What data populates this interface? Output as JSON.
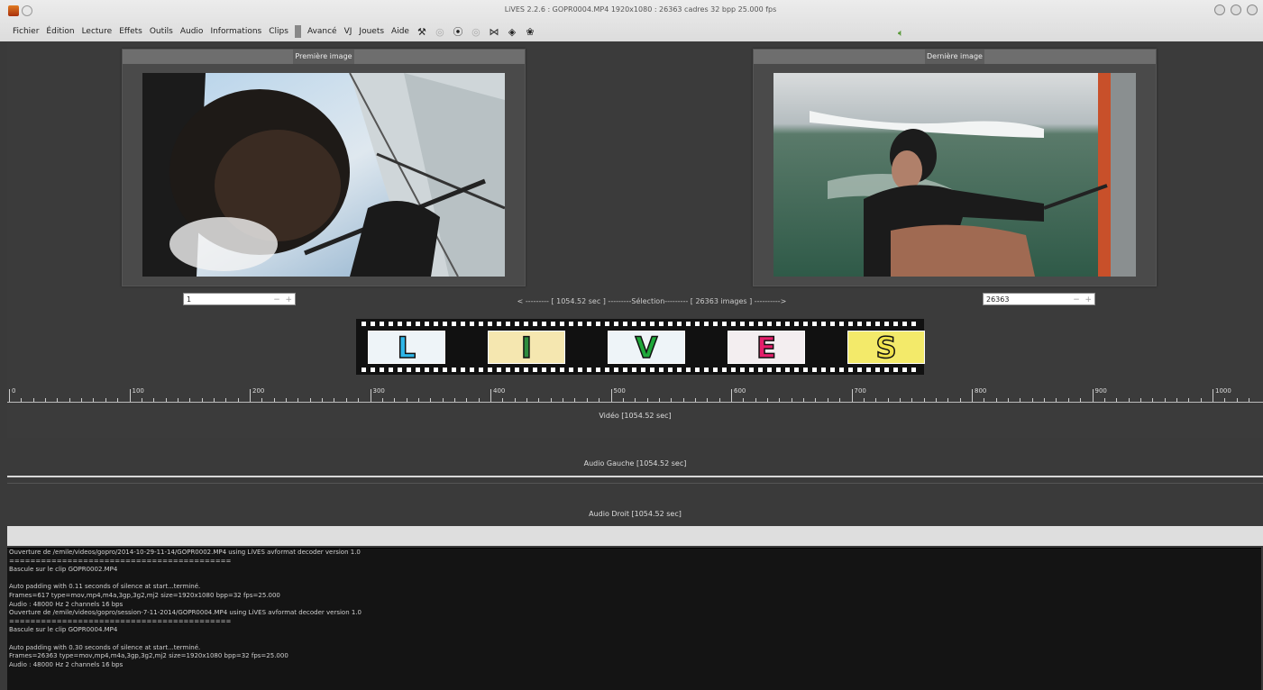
{
  "window": {
    "title": "LiVES 2.2.6 : GOPR0004.MP4 1920x1080 : 26363 cadres 32 bpp 25.000 fps",
    "controls": [
      "minimize-icon",
      "maximize-icon",
      "close-icon"
    ]
  },
  "menu": {
    "items": [
      "Fichier",
      "Édition",
      "Lecture",
      "Effets",
      "Outils",
      "Audio",
      "Informations",
      "Clips",
      "Avancé",
      "VJ",
      "Jouets",
      "Aide"
    ],
    "toolbar_icons": [
      "fx-icon",
      "play-radio-icon",
      "play-circle-icon",
      "record-icon",
      "mute-icon",
      "eye-icon",
      "palette-icon",
      "speaker-icon"
    ]
  },
  "first_frame": {
    "panel_label": "Première image",
    "frame_number": "1"
  },
  "last_frame": {
    "panel_label": "Dernière image",
    "frame_number": "26363"
  },
  "selection": {
    "text": "< --------- [ 1054.52 sec ] ---------Sélection--------- [ 26363 images ] ---------->"
  },
  "filmstrip": {
    "letters": [
      "L",
      "I",
      "V",
      "E",
      "S"
    ],
    "letter_colors": [
      "#2eb6e8",
      "#2e8c3e",
      "#1fa83a",
      "#e51f6b",
      "#f0e24a"
    ]
  },
  "ruler": {
    "labels": [
      "0",
      "100",
      "200",
      "300",
      "400",
      "500",
      "600",
      "700",
      "800",
      "900",
      "1000"
    ]
  },
  "tracks": {
    "video": "Vidéo [1054.52 sec]",
    "audio_left": "Audio Gauche [1054.52 sec]",
    "audio_right": "Audio Droit [1054.52 sec]"
  },
  "console": {
    "lines": [
      "Ouverture de /emile/videos/gopro/2014-10-29-11-14/GOPR0002.MP4 using LiVES avformat decoder version 1.0",
      "==========================================",
      "Bascule sur le clip GOPR0002.MP4",
      "",
      "Auto padding with 0.11 seconds of silence at start...terminé.",
      "Frames=617 type=mov,mp4,m4a,3gp,3g2,mj2 size=1920x1080 bpp=32 fps=25.000",
      "Audio : 48000 Hz 2 channels 16 bps",
      "Ouverture de /emile/videos/gopro/session-7-11-2014/GOPR0004.MP4 using LiVES avformat decoder version 1.0",
      "==========================================",
      "Bascule sur le clip GOPR0004.MP4",
      "",
      "Auto padding with 0.30 seconds of silence at start...terminé.",
      "Frames=26363 type=mov,mp4,m4a,3gp,3g2,mj2 size=1920x1080 bpp=32 fps=25.000",
      "Audio : 48000 Hz 2 channels 16 bps"
    ]
  }
}
